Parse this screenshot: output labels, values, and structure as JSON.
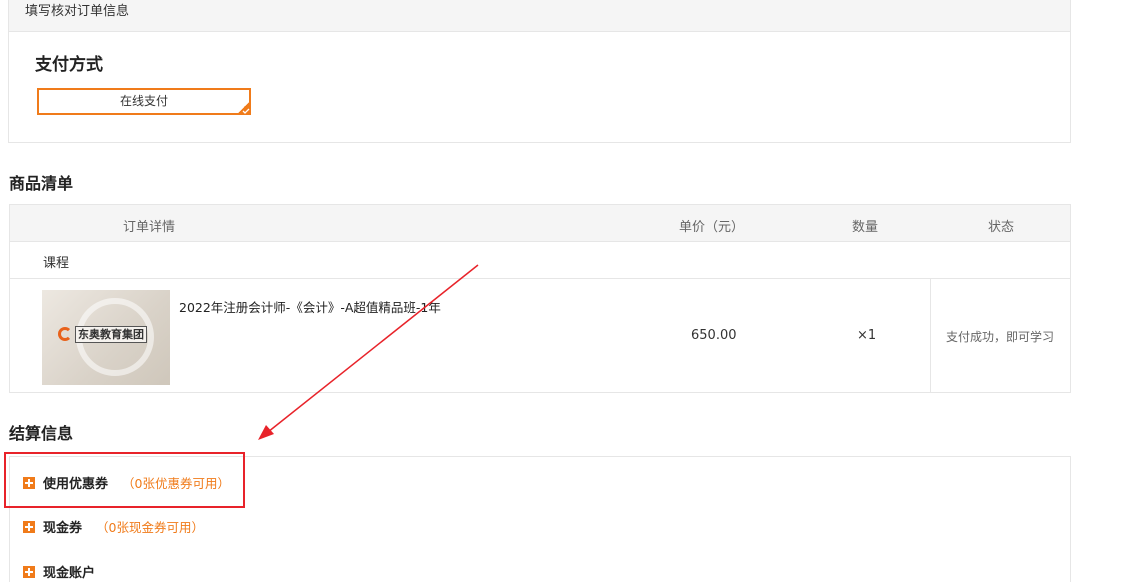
{
  "order_box": {
    "header": "填写核对订单信息",
    "payment_title": "支付方式",
    "payment_option": "在线支付"
  },
  "products": {
    "title": "商品清单",
    "headers": {
      "details": "订单详情",
      "price": "单价（元）",
      "quantity": "数量",
      "status": "状态"
    },
    "category": "课程",
    "items": [
      {
        "thumb_text": "东奥教育集团",
        "name": "2022年注册会计师-《会计》-A超值精品班-1年",
        "price": "650.00",
        "quantity": "×1",
        "status": "支付成功，即可学习"
      }
    ]
  },
  "settlement": {
    "title": "结算信息",
    "items": [
      {
        "label": "使用优惠券",
        "note": "（0张优惠券可用）"
      },
      {
        "label": "现金券",
        "note": "（0张现金券可用）"
      },
      {
        "label": "现金账户",
        "note": ""
      }
    ]
  },
  "colors": {
    "accent": "#f07b1a",
    "annotation_red": "#e8232a"
  }
}
